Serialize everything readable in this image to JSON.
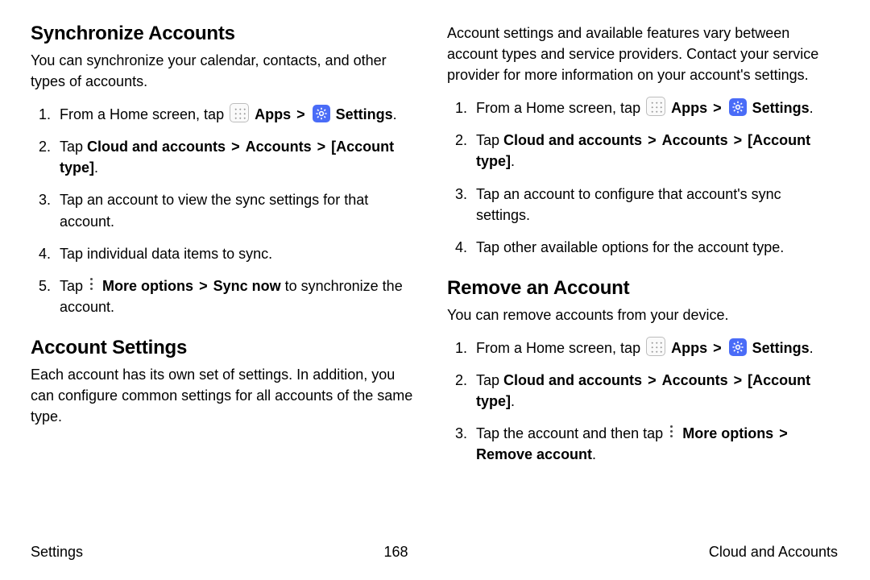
{
  "left": {
    "h1": "Synchronize Accounts",
    "intro": "You can synchronize your calendar, contacts, and other types of accounts.",
    "steps": {
      "s1_a": "From a Home screen, tap ",
      "apps": "Apps",
      "settings": "Settings",
      "s2_a": "Tap ",
      "s2_b": "Cloud and accounts",
      "s2_c": "Accounts",
      "s2_d": "[Account type]",
      "s3": "Tap an account to view the sync settings for that account.",
      "s4": "Tap individual data items to sync.",
      "s5_a": "Tap ",
      "s5_b": "More options",
      "s5_c": "Sync now",
      "s5_d": " to synchronize the account."
    },
    "h2": "Account Settings",
    "p2": "Each account has its own set of settings. In addition, you can configure common settings for all accounts of the same type."
  },
  "right": {
    "intro": "Account settings and available features vary between account types and service providers. Contact your service provider for more information on your account's settings.",
    "steps1": {
      "s1_a": "From a Home screen, tap ",
      "apps": "Apps",
      "settings": "Settings",
      "s2_a": "Tap ",
      "s2_b": "Cloud and accounts",
      "s2_c": "Accounts",
      "s2_d": "[Account type]",
      "s3": "Tap an account to configure that account's sync settings.",
      "s4": "Tap other available options for the account type."
    },
    "h2": "Remove an Account",
    "p2": "You can remove accounts from your device.",
    "steps2": {
      "s1_a": "From a Home screen, tap ",
      "apps": "Apps",
      "settings": "Settings",
      "s2_a": "Tap ",
      "s2_b": "Cloud and accounts",
      "s2_c": "Accounts",
      "s2_d": "[Account type]",
      "s3_a": "Tap the account and then tap ",
      "s3_b": "More options",
      "s3_c": "Remove account"
    }
  },
  "footer": {
    "left": "Settings",
    "center": "168",
    "right": "Cloud and Accounts"
  },
  "gt": ">",
  "dot": "."
}
